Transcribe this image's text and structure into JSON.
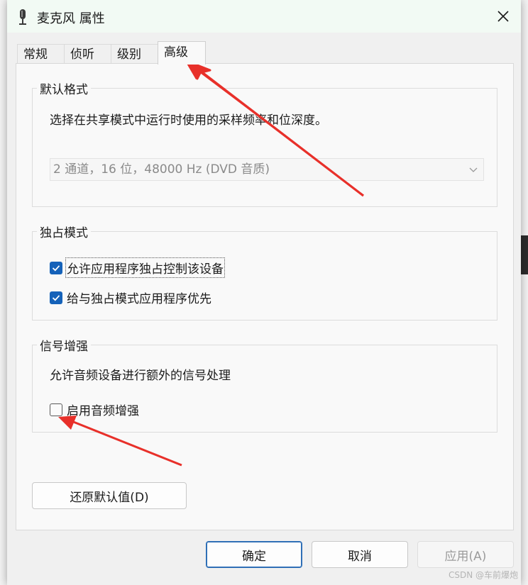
{
  "window": {
    "title": "麦克风 属性",
    "icon": "microphone-icon",
    "close_icon": "close-icon"
  },
  "tabs": [
    {
      "label": "常规",
      "active": false
    },
    {
      "label": "侦听",
      "active": false
    },
    {
      "label": "级别",
      "active": false
    },
    {
      "label": "高级",
      "active": true
    }
  ],
  "default_format": {
    "title": "默认格式",
    "description": "选择在共享模式中运行时使用的采样频率和位深度。",
    "selected": "2 通道，16 位，48000 Hz (DVD 音质)"
  },
  "exclusive_mode": {
    "title": "独占模式",
    "options": [
      {
        "label": "允许应用程序独占控制该设备",
        "checked": true
      },
      {
        "label": "给与独占模式应用程序优先",
        "checked": true
      }
    ]
  },
  "signal_enhancement": {
    "title": "信号增强",
    "description": "允许音频设备进行额外的信号处理",
    "option": {
      "label": "启用音频增强",
      "checked": false
    }
  },
  "buttons": {
    "restore": "还原默认值(D)",
    "ok": "确定",
    "cancel": "取消",
    "apply": "应用(A)"
  },
  "annotation_color": "#e8302a",
  "checkbox_color": "#1562b9",
  "watermark": "CSDN @车前爆炮"
}
